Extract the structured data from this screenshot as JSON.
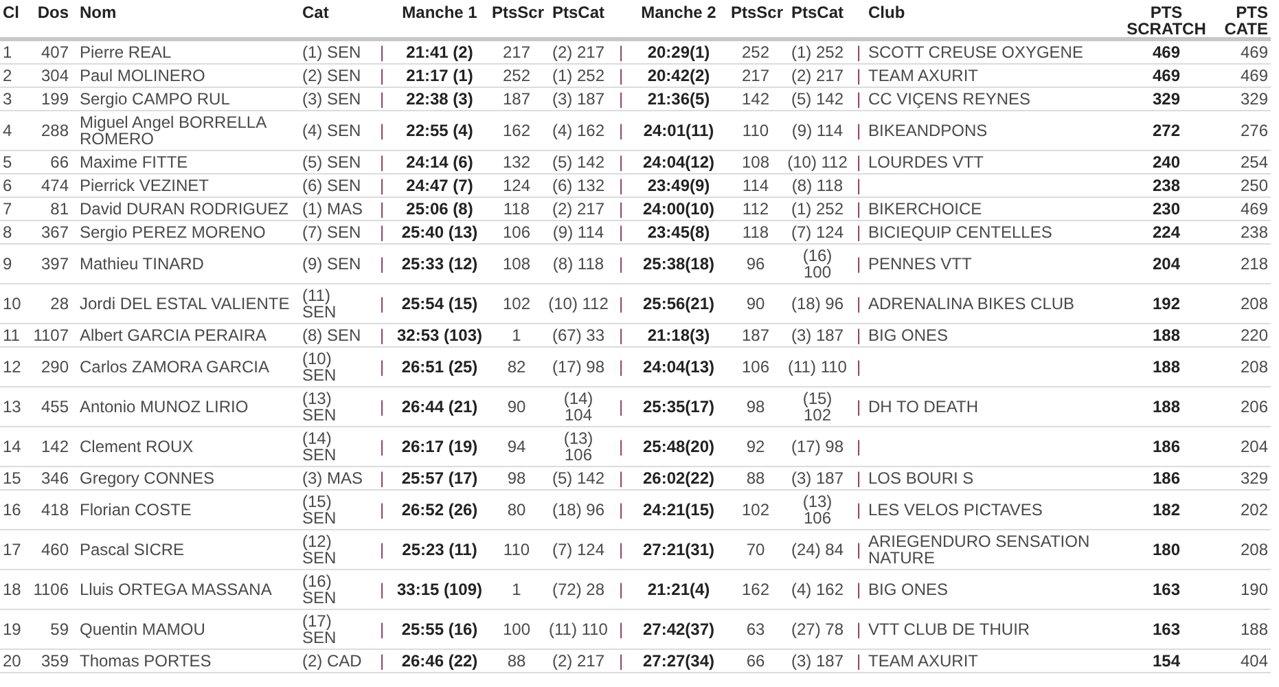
{
  "table": {
    "columns": [
      "Cl",
      "Dos",
      "Nom",
      "Cat",
      "Manche 1",
      "PtsScr",
      "PtsCat",
      "Manche 2",
      "PtsScr",
      "PtsCat",
      "Club",
      "PTS SCRATCH",
      "PTS CATE"
    ],
    "rows": [
      {
        "rank": "1",
        "bib": "407",
        "name": "Pierre REAL",
        "cat": "(1) SEN",
        "sep1": "|",
        "m1_time": "21:41 (2)",
        "m1_pts": "217",
        "m1_cat": "(2) 217",
        "sep2": "|",
        "m2_time": "20:29(1)",
        "m2_pts": "252",
        "m2_cat": "(1) 252",
        "sep3": "|",
        "club": "SCOTT CREUSE OXYGENE",
        "pts_scratch": "469",
        "pts_cate": "469"
      },
      {
        "rank": "2",
        "bib": "304",
        "name": "Paul MOLINERO",
        "cat": "(2) SEN",
        "sep1": "|",
        "m1_time": "21:17 (1)",
        "m1_pts": "252",
        "m1_cat": "(1) 252",
        "sep2": "|",
        "m2_time": "20:42(2)",
        "m2_pts": "217",
        "m2_cat": "(2) 217",
        "sep3": "|",
        "club": "TEAM AXURIT",
        "pts_scratch": "469",
        "pts_cate": "469"
      },
      {
        "rank": "3",
        "bib": "199",
        "name": "Sergio CAMPO RUL",
        "cat": "(3) SEN",
        "sep1": "|",
        "m1_time": "22:38 (3)",
        "m1_pts": "187",
        "m1_cat": "(3) 187",
        "sep2": "|",
        "m2_time": "21:36(5)",
        "m2_pts": "142",
        "m2_cat": "(5) 142",
        "sep3": "|",
        "club": "CC VIÇENS REYNES",
        "pts_scratch": "329",
        "pts_cate": "329"
      },
      {
        "rank": "4",
        "bib": "288",
        "name": "Miguel Angel BORRELLA ROMERO",
        "cat": "(4) SEN",
        "sep1": "|",
        "m1_time": "22:55 (4)",
        "m1_pts": "162",
        "m1_cat": "(4) 162",
        "sep2": "|",
        "m2_time": "24:01(11)",
        "m2_pts": "110",
        "m2_cat": "(9) 114",
        "sep3": "|",
        "club": "BIKEANDPONS",
        "pts_scratch": "272",
        "pts_cate": "276"
      },
      {
        "rank": "5",
        "bib": "66",
        "name": "Maxime FITTE",
        "cat": "(5) SEN",
        "sep1": "|",
        "m1_time": "24:14 (6)",
        "m1_pts": "132",
        "m1_cat": "(5) 142",
        "sep2": "|",
        "m2_time": "24:04(12)",
        "m2_pts": "108",
        "m2_cat": "(10) 112",
        "sep3": "|",
        "club": "LOURDES VTT",
        "pts_scratch": "240",
        "pts_cate": "254"
      },
      {
        "rank": "6",
        "bib": "474",
        "name": "Pierrick VEZINET",
        "cat": "(6) SEN",
        "sep1": "|",
        "m1_time": "24:47 (7)",
        "m1_pts": "124",
        "m1_cat": "(6) 132",
        "sep2": "|",
        "m2_time": "23:49(9)",
        "m2_pts": "114",
        "m2_cat": "(8) 118",
        "sep3": "|",
        "pts_scratch": "238",
        "pts_cate": "250"
      },
      {
        "rank": "7",
        "bib": "81",
        "name": "David DURAN RODRIGUEZ",
        "cat": "(1) MAS",
        "sep1": "|",
        "m1_time": "25:06 (8)",
        "m1_pts": "118",
        "m1_cat": "(2) 217",
        "sep2": "|",
        "m2_time": "24:00(10)",
        "m2_pts": "112",
        "m2_cat": "(1) 252",
        "sep3": "|",
        "club": "BIKERCHOICE",
        "pts_scratch": "230",
        "pts_cate": "469"
      },
      {
        "rank": "8",
        "bib": "367",
        "name": "Sergio PEREZ MORENO",
        "cat": "(7) SEN",
        "sep1": "|",
        "m1_time": "25:40 (13)",
        "m1_pts": "106",
        "m1_cat": "(9) 114",
        "sep2": "|",
        "m2_time": "23:45(8)",
        "m2_pts": "118",
        "m2_cat": "(7) 124",
        "sep3": "|",
        "club": "BICIEQUIP CENTELLES",
        "pts_scratch": "224",
        "pts_cate": "238"
      },
      {
        "rank": "9",
        "bib": "397",
        "name": "Mathieu TINARD",
        "cat": "(9) SEN",
        "sep1": "|",
        "m1_time": "25:33 (12)",
        "m1_pts": "108",
        "m1_cat": "(8) 118",
        "sep2": "|",
        "m2_time": "25:38(18)",
        "m2_pts": "96",
        "m2_cat": "(16) 100",
        "sep3": "|",
        "club": "PENNES VTT",
        "pts_scratch": "204",
        "pts_cate": "218"
      },
      {
        "rank": "10",
        "bib": "28",
        "name": "Jordi DEL ESTAL VALIENTE",
        "cat": "(11) SEN",
        "sep1": "|",
        "m1_time": "25:54 (15)",
        "m1_pts": "102",
        "m1_cat": "(10) 112",
        "sep2": "|",
        "m2_time": "25:56(21)",
        "m2_pts": "90",
        "m2_cat": "(18) 96",
        "sep3": "|",
        "club": "ADRENALINA BIKES CLUB",
        "pts_scratch": "192",
        "pts_cate": "208"
      },
      {
        "rank": "11",
        "bib": "1107",
        "name": "Albert GARCIA PERAIRA",
        "cat": "(8) SEN",
        "sep1": "|",
        "m1_time": "32:53 (103)",
        "m1_pts": "1",
        "m1_cat": "(67) 33",
        "sep2": "|",
        "m2_time": "21:18(3)",
        "m2_pts": "187",
        "m2_cat": "(3) 187",
        "sep3": "|",
        "club": "BIG ONES",
        "pts_scratch": "188",
        "pts_cate": "220"
      },
      {
        "rank": "12",
        "bib": "290",
        "name": "Carlos ZAMORA GARCIA",
        "cat": "(10) SEN",
        "sep1": "|",
        "m1_time": "26:51 (25)",
        "m1_pts": "82",
        "m1_cat": "(17) 98",
        "sep2": "|",
        "m2_time": "24:04(13)",
        "m2_pts": "106",
        "m2_cat": "(11) 110",
        "sep3": "|",
        "pts_scratch": "188",
        "pts_cate": "208"
      },
      {
        "rank": "13",
        "bib": "455",
        "name": "Antonio MUNOZ LIRIO",
        "cat": "(13) SEN",
        "sep1": "|",
        "m1_time": "26:44 (21)",
        "m1_pts": "90",
        "m1_cat": "(14) 104",
        "sep2": "|",
        "m2_time": "25:35(17)",
        "m2_pts": "98",
        "m2_cat": "(15) 102",
        "sep3": "|",
        "club": "DH TO DEATH",
        "pts_scratch": "188",
        "pts_cate": "206"
      },
      {
        "rank": "14",
        "bib": "142",
        "name": "Clement ROUX",
        "cat": "(14) SEN",
        "sep1": "|",
        "m1_time": "26:17 (19)",
        "m1_pts": "94",
        "m1_cat": "(13) 106",
        "sep2": "|",
        "m2_time": "25:48(20)",
        "m2_pts": "92",
        "m2_cat": "(17) 98",
        "sep3": "|",
        "pts_scratch": "186",
        "pts_cate": "204"
      },
      {
        "rank": "15",
        "bib": "346",
        "name": "Gregory CONNES",
        "cat": "(3) MAS",
        "sep1": "|",
        "m1_time": "25:57 (17)",
        "m1_pts": "98",
        "m1_cat": "(5) 142",
        "sep2": "|",
        "m2_time": "26:02(22)",
        "m2_pts": "88",
        "m2_cat": "(3) 187",
        "sep3": "|",
        "club": "LOS BOURI S",
        "pts_scratch": "186",
        "pts_cate": "329"
      },
      {
        "rank": "16",
        "bib": "418",
        "name": "Florian COSTE",
        "cat": "(15) SEN",
        "sep1": "|",
        "m1_time": "26:52 (26)",
        "m1_pts": "80",
        "m1_cat": "(18) 96",
        "sep2": "|",
        "m2_time": "24:21(15)",
        "m2_pts": "102",
        "m2_cat": "(13) 106",
        "sep3": "|",
        "club": "LES VELOS PICTAVES",
        "pts_scratch": "182",
        "pts_cate": "202"
      },
      {
        "rank": "17",
        "bib": "460",
        "name": "Pascal SICRE",
        "cat": "(12) SEN",
        "sep1": "|",
        "m1_time": "25:23 (11)",
        "m1_pts": "110",
        "m1_cat": "(7) 124",
        "sep2": "|",
        "m2_time": "27:21(31)",
        "m2_pts": "70",
        "m2_cat": "(24) 84",
        "sep3": "|",
        "club": "ARIEGENDURO SENSATION NATURE",
        "pts_scratch": "180",
        "pts_cate": "208"
      },
      {
        "rank": "18",
        "bib": "1106",
        "name": "Lluis ORTEGA MASSANA",
        "cat": "(16) SEN",
        "sep1": "|",
        "m1_time": "33:15 (109)",
        "m1_pts": "1",
        "m1_cat": "(72) 28",
        "sep2": "|",
        "m2_time": "21:21(4)",
        "m2_pts": "162",
        "m2_cat": "(4) 162",
        "sep3": "|",
        "club": "BIG ONES",
        "pts_scratch": "163",
        "pts_cate": "190"
      },
      {
        "rank": "19",
        "bib": "59",
        "name": "Quentin MAMOU",
        "cat": "(17) SEN",
        "sep1": "|",
        "m1_time": "25:55 (16)",
        "m1_pts": "100",
        "m1_cat": "(11) 110",
        "sep2": "|",
        "m2_time": "27:42(37)",
        "m2_pts": "63",
        "m2_cat": "(27) 78",
        "sep3": "|",
        "club": "VTT CLUB DE THUIR",
        "pts_scratch": "163",
        "pts_cate": "188"
      },
      {
        "rank": "20",
        "bib": "359",
        "name": "Thomas PORTES",
        "cat": "(2) CAD",
        "sep1": "|",
        "m1_time": "26:46 (22)",
        "m1_pts": "88",
        "m1_cat": "(2) 217",
        "sep2": "|",
        "m2_time": "27:27(34)",
        "m2_pts": "66",
        "m2_cat": "(3) 187",
        "sep3": "|",
        "club": "TEAM AXURIT",
        "pts_scratch": "154",
        "pts_cate": "404"
      }
    ]
  }
}
